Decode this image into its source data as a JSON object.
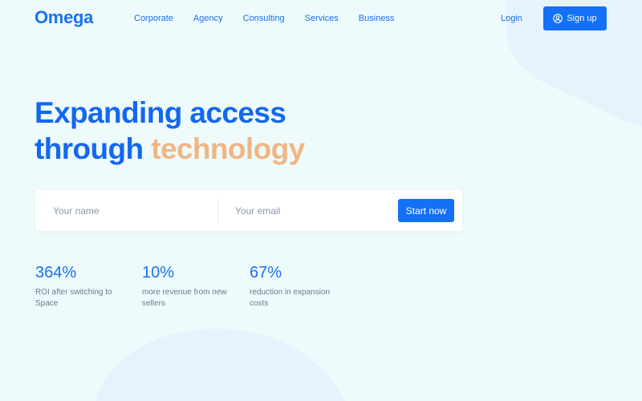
{
  "brand": {
    "name": "Omega",
    "color": "#1a73f0",
    "accent_color": "#f1b583"
  },
  "nav": {
    "links": [
      "Corporate",
      "Agency",
      "Consulting",
      "Services",
      "Business"
    ],
    "login": "Login",
    "signup": "Sign up",
    "signup_icon": "user-icon"
  },
  "hero": {
    "line1": "Expanding access",
    "line2_start": "through ",
    "line2_accent": "technology"
  },
  "form": {
    "name_placeholder": "Your name",
    "email_placeholder": "Your email",
    "submit_label": "Start now"
  },
  "stats": [
    {
      "value": "364%",
      "desc": "ROI after switching to Space"
    },
    {
      "value": "10%",
      "desc": "more revenue from new sellers"
    },
    {
      "value": "67%",
      "desc": "reduction in expansion costs"
    }
  ]
}
